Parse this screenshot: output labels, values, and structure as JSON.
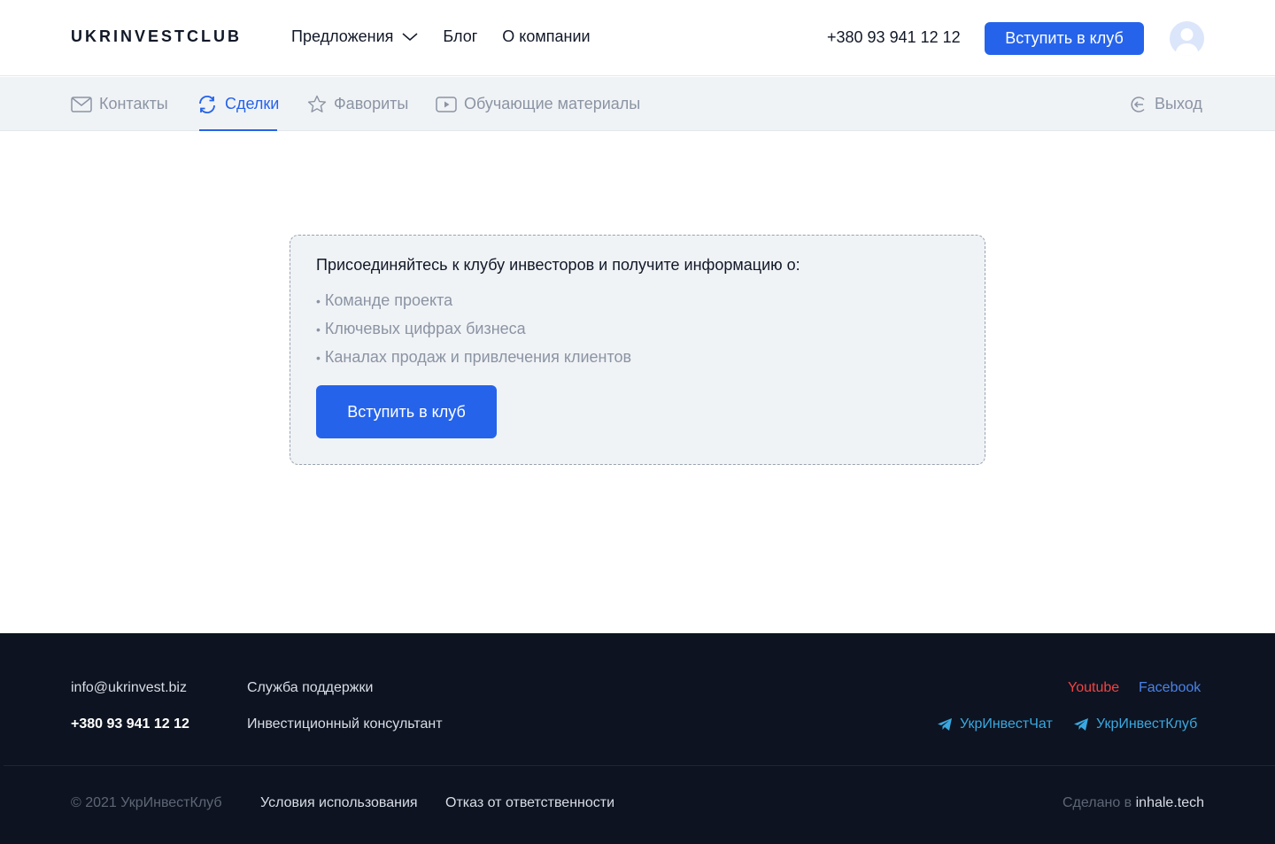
{
  "header": {
    "logo": "UKRINVESTCLUB",
    "nav": [
      {
        "label": "Предложения",
        "has_dropdown": true
      },
      {
        "label": "Блог"
      },
      {
        "label": "О компании"
      }
    ],
    "phone": "+380 93 941 12 12",
    "join_button": "Вступить в клуб",
    "avatar_icon": "user-avatar-icon"
  },
  "subnav": {
    "tabs": [
      {
        "label": "Контакты",
        "icon": "mail-icon",
        "active": false
      },
      {
        "label": "Сделки",
        "icon": "refresh-icon",
        "active": true
      },
      {
        "label": "Фавориты",
        "icon": "star-icon",
        "active": false
      },
      {
        "label": "Обучающие материалы",
        "icon": "video-icon",
        "active": false
      }
    ],
    "logout": {
      "label": "Выход",
      "icon": "logout-icon"
    }
  },
  "card": {
    "title": "Присоединяйтесь к клубу инвесторов и получите информацию о:",
    "items": [
      "Команде проекта",
      "Ключевых цифрах бизнеса",
      "Каналах продаж и привлечения клиентов"
    ],
    "button": "Вступить в клуб"
  },
  "footer": {
    "email": "info@ukrinvest.biz",
    "phone": "+380 93 941 12 12",
    "links": [
      "Служба поддержки",
      "Инвестиционный консультант"
    ],
    "social": {
      "youtube": "Youtube",
      "facebook": "Facebook"
    },
    "telegram": [
      "УкрИнвестЧат",
      "УкрИнвестКлуб"
    ],
    "copyright": "© 2021 УкрИнвестКлуб",
    "legal": [
      "Условия использования",
      "Отказ от ответственности"
    ],
    "made_in_prefix": "Сделано в",
    "made_in_link": "inhale.tech"
  },
  "colors": {
    "accent": "#2563eb",
    "footer_bg": "#0d1320",
    "subnav_bg": "#f0f3f6",
    "muted_text": "#8b94a3",
    "youtube": "#ef4444",
    "facebook": "#4b83e8",
    "telegram": "#3aa8e0"
  }
}
